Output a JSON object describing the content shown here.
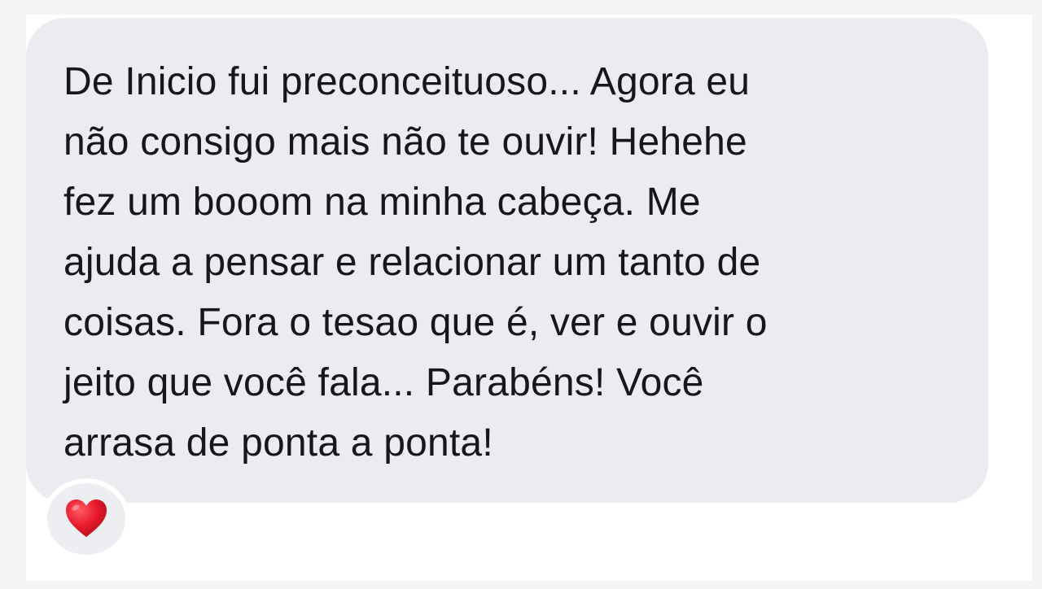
{
  "message": {
    "lines": [
      "De Inicio fui preconceituoso... Agora eu",
      "não consigo mais não te ouvir! Hehehe",
      "fez um booom na minha cabeça. Me",
      "ajuda a pensar e relacionar um tanto de",
      "coisas. Fora o tesao que é, ver e ouvir o",
      "jeito que você fala... Parabéns! Você",
      "arrasa de ponta a ponta!"
    ]
  },
  "reaction": {
    "icon": "heart-icon",
    "color": "#e8192c"
  },
  "colors": {
    "page_background": "#f4f4f6",
    "bubble_background": "#eaecf0",
    "text": "#16171a"
  }
}
